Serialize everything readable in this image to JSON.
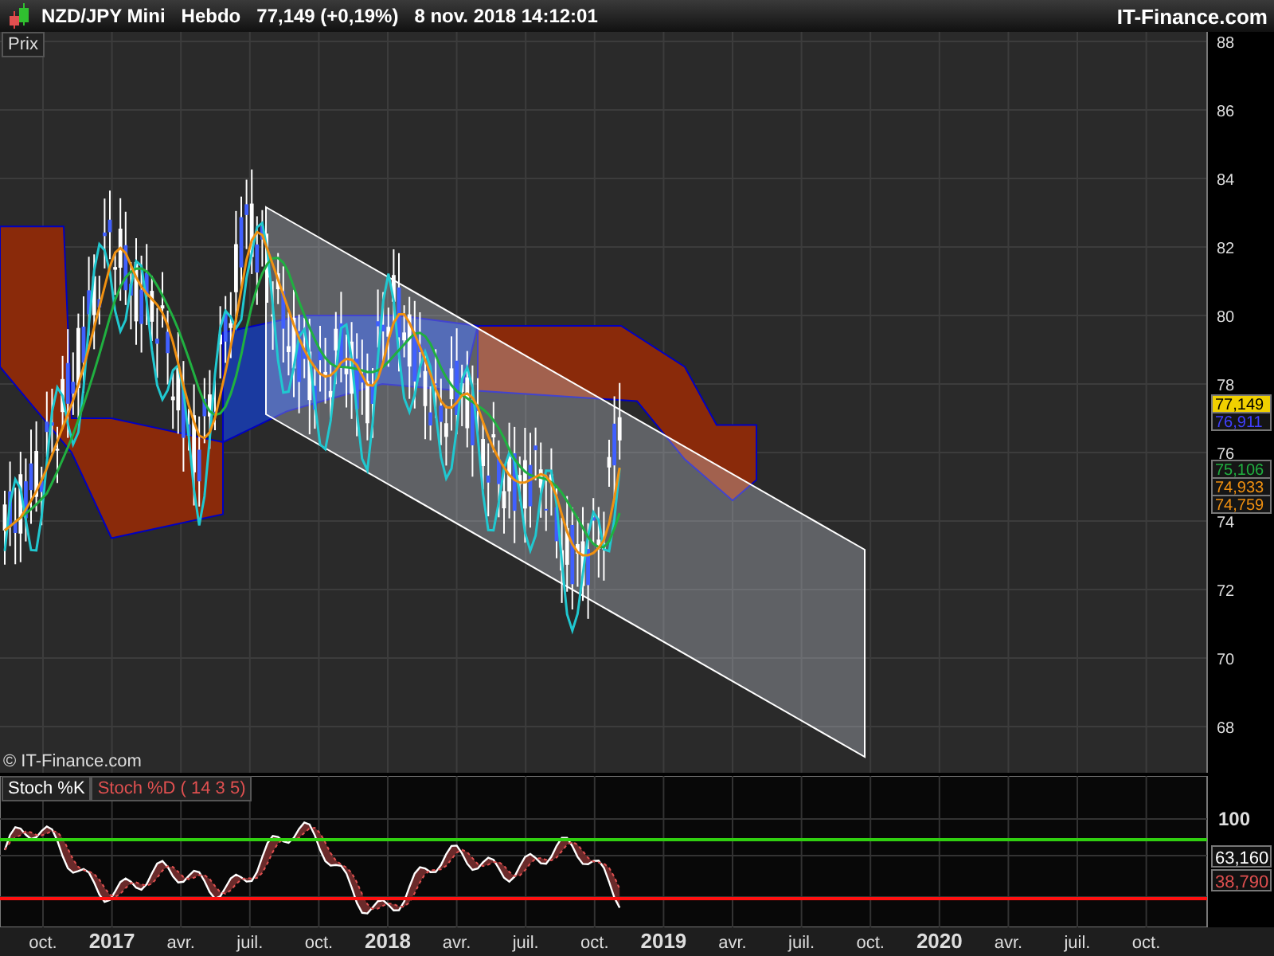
{
  "header": {
    "symbol": "NZD/JPY Mini",
    "period": "Hebdo",
    "quote": "77,149 (+0,19%)",
    "datetime": "8 nov. 2018 14:12:01",
    "brand": "IT-Finance.com"
  },
  "price_panel": {
    "label": "Prix",
    "copyright": "© IT-Finance.com",
    "y_ticks": [
      "88",
      "86",
      "84",
      "82",
      "80",
      "78",
      "76",
      "74",
      "72",
      "70",
      "68"
    ],
    "price_tags": [
      {
        "text": "77,149",
        "color": "#f0d000",
        "filled": true
      },
      {
        "text": "76,911",
        "color": "#4040ff",
        "filled": false
      },
      {
        "text": "75,106",
        "color": "#20b040",
        "filled": false
      },
      {
        "text": "74,933",
        "color": "#f09010",
        "filled": false
      },
      {
        "text": "74,759",
        "color": "#f09010",
        "filled": false
      }
    ]
  },
  "stoch_panel": {
    "legend": [
      {
        "text": "Stoch %K",
        "color": "#ffffff"
      },
      {
        "text": "Stoch %D ( 14 3 5)",
        "color": "#e05050"
      }
    ],
    "y_ticks": [
      "100"
    ],
    "tags": [
      {
        "text": "63,160",
        "color": "#ffffff"
      },
      {
        "text": "38,790",
        "color": "#e05050"
      }
    ]
  },
  "x_axis": {
    "labels": [
      {
        "text": "oct.",
        "bold": false
      },
      {
        "text": "2017",
        "bold": true
      },
      {
        "text": "avr.",
        "bold": false
      },
      {
        "text": "juil.",
        "bold": false
      },
      {
        "text": "oct.",
        "bold": false
      },
      {
        "text": "2018",
        "bold": true
      },
      {
        "text": "avr.",
        "bold": false
      },
      {
        "text": "juil.",
        "bold": false
      },
      {
        "text": "oct.",
        "bold": false
      },
      {
        "text": "2019",
        "bold": true
      },
      {
        "text": "avr.",
        "bold": false
      },
      {
        "text": "juil.",
        "bold": false
      },
      {
        "text": "oct.",
        "bold": false
      },
      {
        "text": "2020",
        "bold": true
      },
      {
        "text": "avr.",
        "bold": false
      },
      {
        "text": "juil.",
        "bold": false
      },
      {
        "text": "oct.",
        "bold": false
      }
    ]
  }
}
